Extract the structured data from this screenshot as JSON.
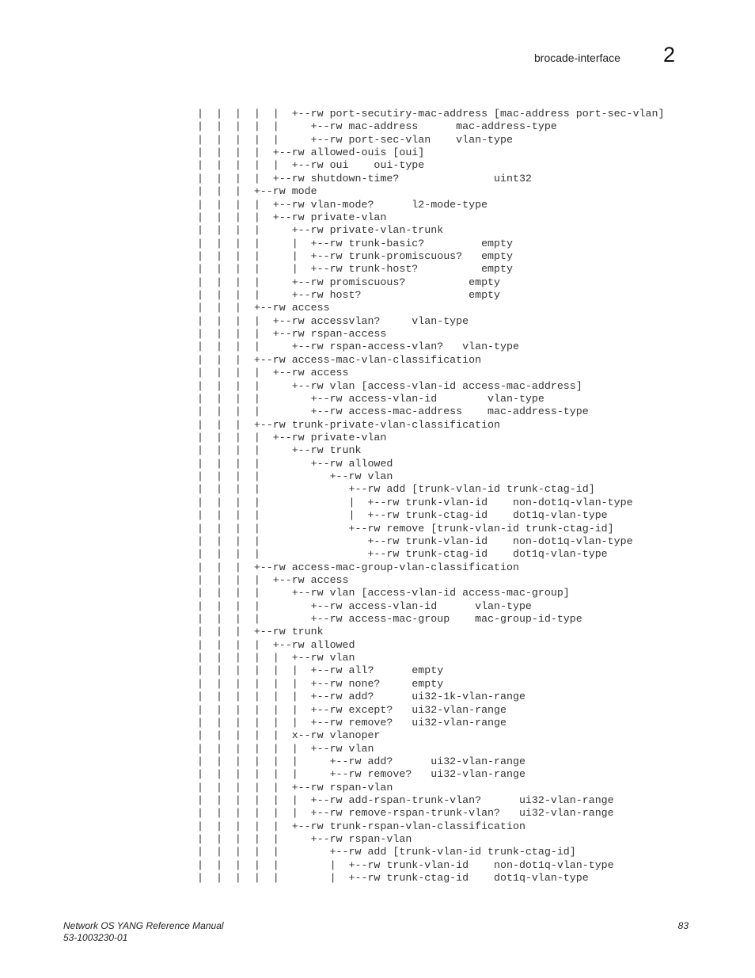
{
  "header": {
    "section_title": "brocade-interface",
    "chapter_number": "2"
  },
  "tree_lines": [
    "|  |  |  |  |  +--rw port-secutiry-mac-address [mac-address port-sec-vlan]",
    "|  |  |  |  |     +--rw mac-address      mac-address-type",
    "|  |  |  |  |     +--rw port-sec-vlan    vlan-type",
    "|  |  |  |  +--rw allowed-ouis [oui]",
    "|  |  |  |  |  +--rw oui    oui-type",
    "|  |  |  |  +--rw shutdown-time?               uint32",
    "|  |  |  +--rw mode",
    "|  |  |  |  +--rw vlan-mode?      l2-mode-type",
    "|  |  |  |  +--rw private-vlan",
    "|  |  |  |     +--rw private-vlan-trunk",
    "|  |  |  |     |  +--rw trunk-basic?         empty",
    "|  |  |  |     |  +--rw trunk-promiscuous?   empty",
    "|  |  |  |     |  +--rw trunk-host?          empty",
    "|  |  |  |     +--rw promiscuous?          empty",
    "|  |  |  |     +--rw host?                 empty",
    "|  |  |  +--rw access",
    "|  |  |  |  +--rw accessvlan?     vlan-type",
    "|  |  |  |  +--rw rspan-access",
    "|  |  |  |     +--rw rspan-access-vlan?   vlan-type",
    "|  |  |  +--rw access-mac-vlan-classification",
    "|  |  |  |  +--rw access",
    "|  |  |  |     +--rw vlan [access-vlan-id access-mac-address]",
    "|  |  |  |        +--rw access-vlan-id        vlan-type",
    "|  |  |  |        +--rw access-mac-address    mac-address-type",
    "|  |  |  +--rw trunk-private-vlan-classification",
    "|  |  |  |  +--rw private-vlan",
    "|  |  |  |     +--rw trunk",
    "|  |  |  |        +--rw allowed",
    "|  |  |  |           +--rw vlan",
    "|  |  |  |              +--rw add [trunk-vlan-id trunk-ctag-id]",
    "|  |  |  |              |  +--rw trunk-vlan-id    non-dot1q-vlan-type",
    "|  |  |  |              |  +--rw trunk-ctag-id    dot1q-vlan-type",
    "|  |  |  |              +--rw remove [trunk-vlan-id trunk-ctag-id]",
    "|  |  |  |                 +--rw trunk-vlan-id    non-dot1q-vlan-type",
    "|  |  |  |                 +--rw trunk-ctag-id    dot1q-vlan-type",
    "|  |  |  +--rw access-mac-group-vlan-classification",
    "|  |  |  |  +--rw access",
    "|  |  |  |     +--rw vlan [access-vlan-id access-mac-group]",
    "|  |  |  |        +--rw access-vlan-id      vlan-type",
    "|  |  |  |        +--rw access-mac-group    mac-group-id-type",
    "|  |  |  +--rw trunk",
    "|  |  |  |  +--rw allowed",
    "|  |  |  |  |  +--rw vlan",
    "|  |  |  |  |  |  +--rw all?      empty",
    "|  |  |  |  |  |  +--rw none?     empty",
    "|  |  |  |  |  |  +--rw add?      ui32-1k-vlan-range",
    "|  |  |  |  |  |  +--rw except?   ui32-vlan-range",
    "|  |  |  |  |  |  +--rw remove?   ui32-vlan-range",
    "|  |  |  |  |  x--rw vlanoper",
    "|  |  |  |  |  |  +--rw vlan",
    "|  |  |  |  |  |     +--rw add?      ui32-vlan-range",
    "|  |  |  |  |  |     +--rw remove?   ui32-vlan-range",
    "|  |  |  |  |  +--rw rspan-vlan",
    "|  |  |  |  |  |  +--rw add-rspan-trunk-vlan?      ui32-vlan-range",
    "|  |  |  |  |  |  +--rw remove-rspan-trunk-vlan?   ui32-vlan-range",
    "|  |  |  |  |  +--rw trunk-rspan-vlan-classification",
    "|  |  |  |  |     +--rw rspan-vlan",
    "|  |  |  |  |        +--rw add [trunk-vlan-id trunk-ctag-id]",
    "|  |  |  |  |        |  +--rw trunk-vlan-id    non-dot1q-vlan-type",
    "|  |  |  |  |        |  +--rw trunk-ctag-id    dot1q-vlan-type"
  ],
  "footer": {
    "manual_title": "Network OS YANG Reference Manual",
    "document_number": "53-1003230-01",
    "page_number": "83"
  }
}
